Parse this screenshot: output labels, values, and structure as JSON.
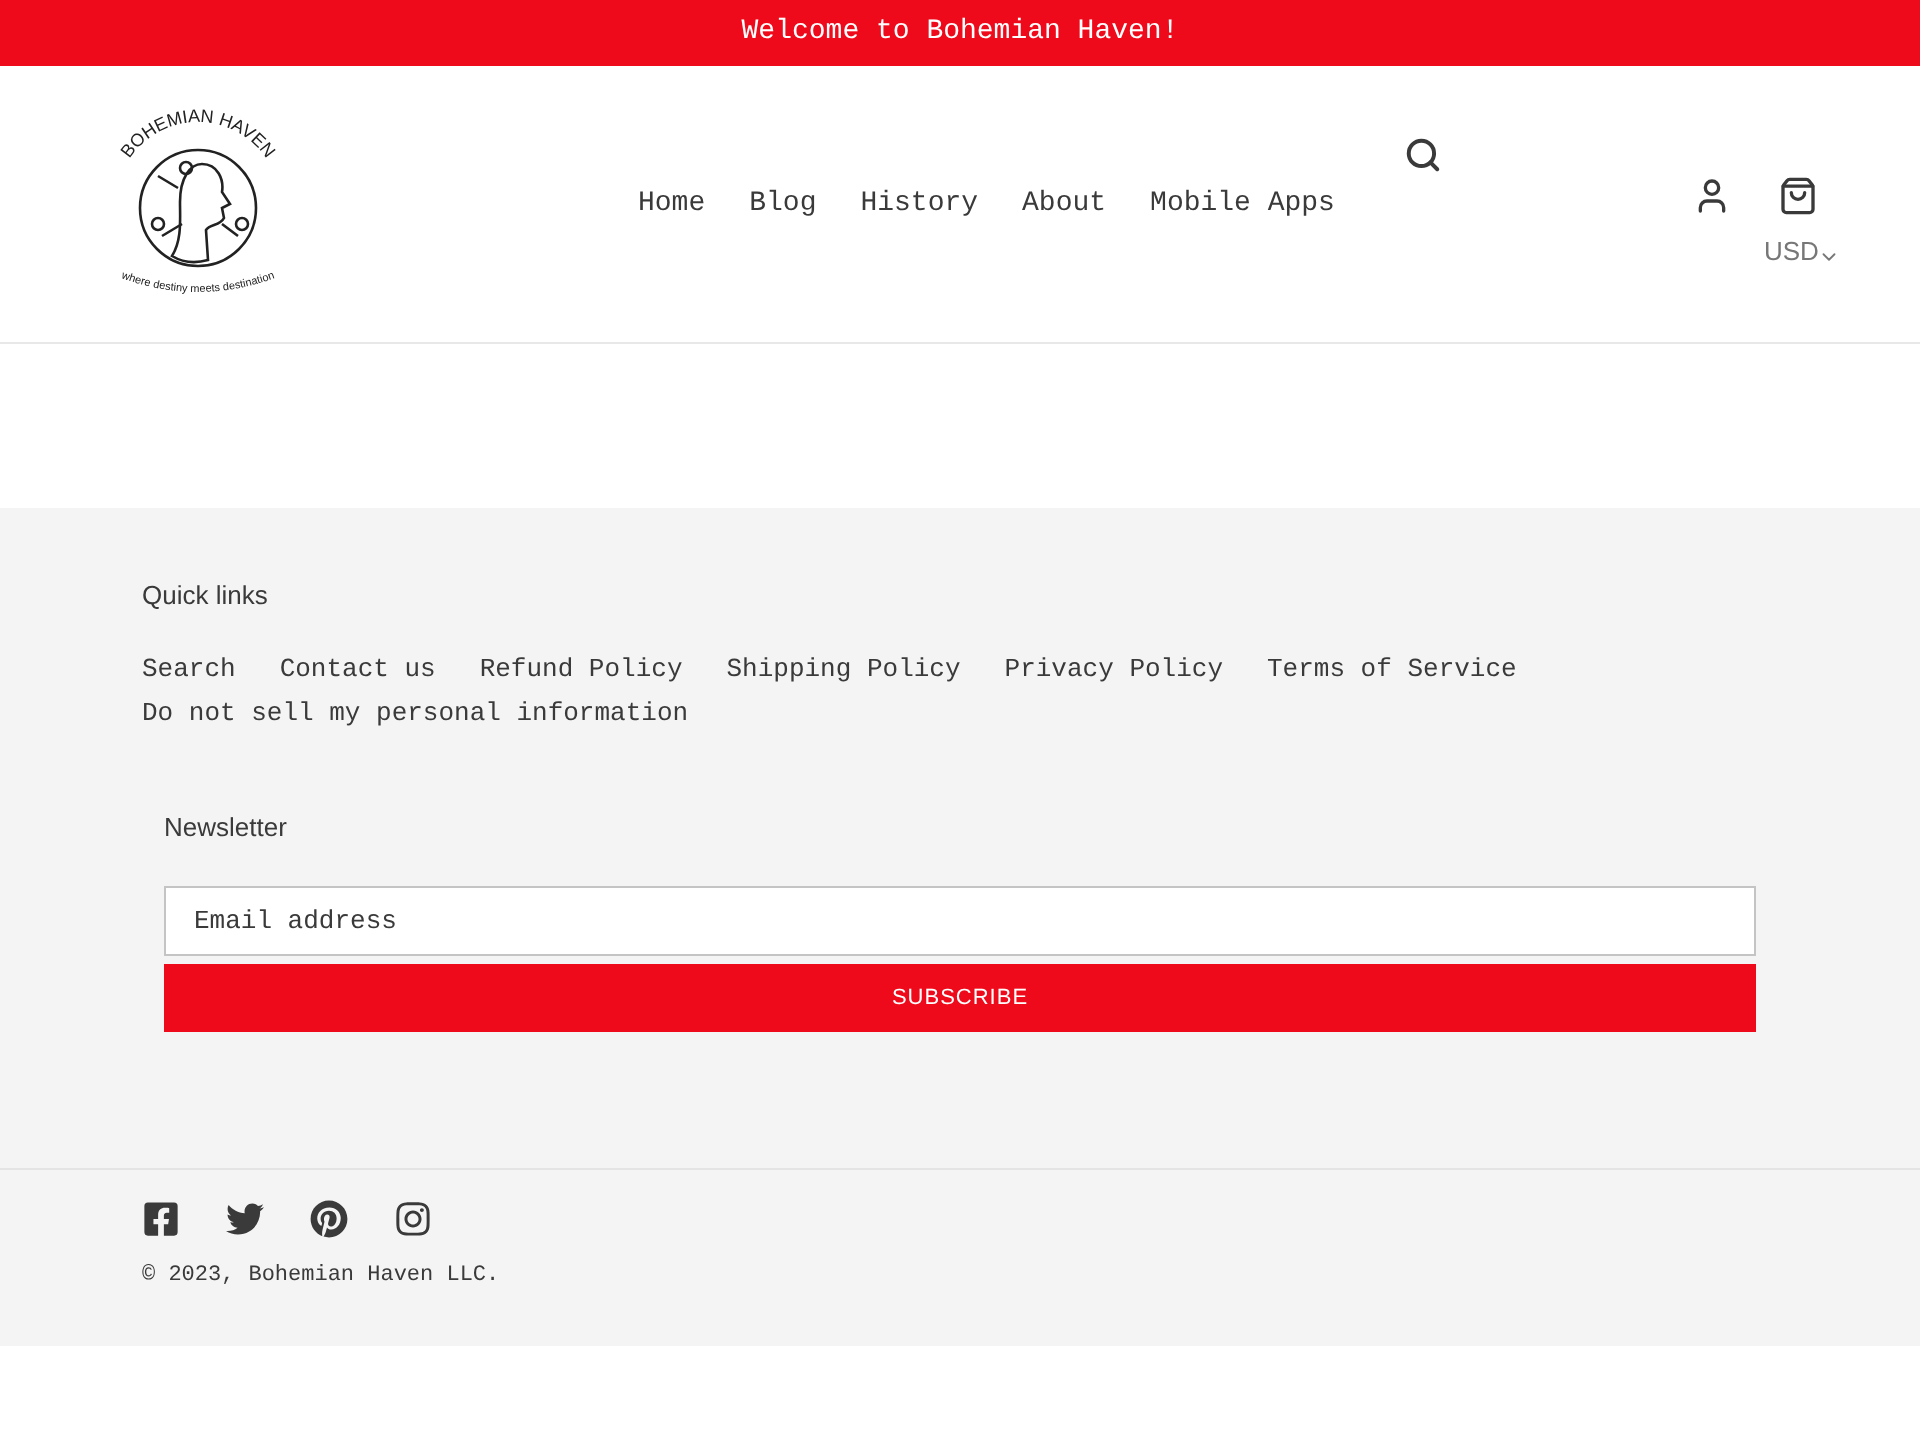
{
  "announcement": "Welcome to Bohemian Haven!",
  "logo": {
    "title": "BOHEMIAN HAVEN",
    "tagline": "where destiny meets destination"
  },
  "nav": [
    {
      "label": "Home"
    },
    {
      "label": "Blog"
    },
    {
      "label": "History"
    },
    {
      "label": "About"
    },
    {
      "label": "Mobile Apps"
    }
  ],
  "currency": "USD",
  "footer": {
    "quick_links_title": "Quick links",
    "links": [
      "Search",
      "Contact us",
      "Refund Policy",
      "Shipping Policy",
      "Privacy Policy",
      "Terms of Service",
      "Do not sell my personal information"
    ],
    "newsletter_title": "Newsletter",
    "email": {
      "placeholder": "Email address"
    },
    "subscribe": "SUBSCRIBE",
    "copyright_prefix": "© 2023,",
    "copyright_link": "Bohemian Haven LLC."
  }
}
